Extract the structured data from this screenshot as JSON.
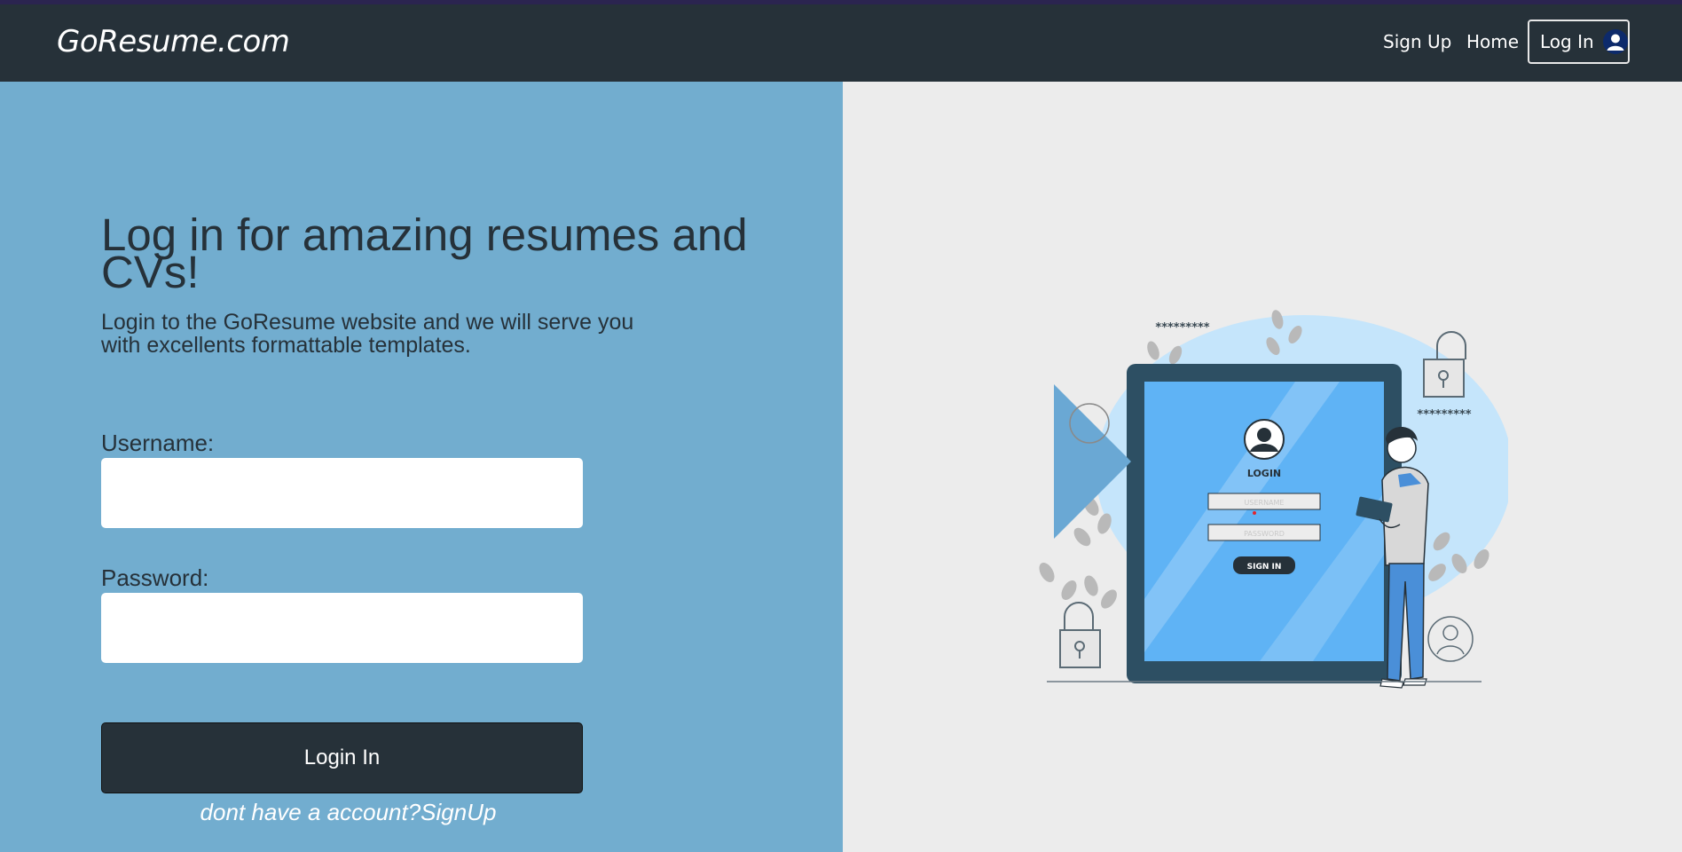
{
  "brand": "GoResume.com",
  "nav": {
    "signup": "Sign Up",
    "home": "Home",
    "login": "Log In"
  },
  "hero": {
    "title": "Log in for amazing resumes and CVs!",
    "subtitle": "Login to the GoResume website and we will serve you with excellents formattable templates."
  },
  "form": {
    "username_label": "Username:",
    "username_value": "",
    "password_label": "Password:",
    "password_value": "",
    "submit_label": "Login In",
    "signup_prompt": "dont have a account?",
    "signup_link": "SignUp"
  },
  "illustration": {
    "screen_title": "LOGIN",
    "username_placeholder": "USERNAME",
    "password_placeholder": "PASSWORD",
    "signin_label": "SIGN IN",
    "mask_text_1": "*********",
    "mask_text_2": "*********"
  },
  "colors": {
    "navbar": "#263139",
    "left_panel": "#72adcf",
    "right_panel": "#ececec",
    "button": "#263139",
    "illustration_blue": "#5fb3f5"
  }
}
